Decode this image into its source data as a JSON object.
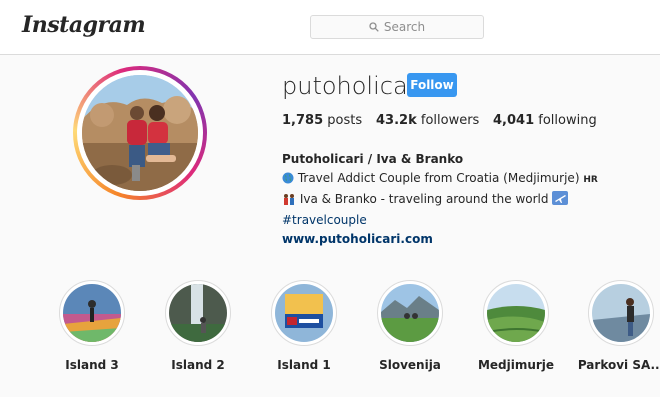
{
  "header": {
    "logo": "Instagram",
    "search_placeholder": "Search"
  },
  "profile": {
    "username": "putoholicari",
    "follow_label": "Follow",
    "posts_count": "1,785",
    "posts_label": "posts",
    "followers_count": "43.2k",
    "followers_label": "followers",
    "following_count": "4,041",
    "following_label": "following",
    "full_name": "Putoholicari / Iva & Branko",
    "bio_line1": "Travel Addict Couple from Croatia (Medjimurje)",
    "bio_line1_suffix": "HR",
    "bio_line2": "Iva & Branko - traveling around the world",
    "hashtag": "#travelcouple",
    "website": "www.putoholicari.com"
  },
  "highlights": [
    {
      "label": "Island 3",
      "icon": "highlight-island3"
    },
    {
      "label": "Island 2",
      "icon": "highlight-island2"
    },
    {
      "label": "Island 1",
      "icon": "highlight-island1"
    },
    {
      "label": "Slovenija",
      "icon": "highlight-slovenija"
    },
    {
      "label": "Medjimurje",
      "icon": "highlight-medjimurje"
    },
    {
      "label": "Parkovi SA...",
      "icon": "highlight-parkovi"
    }
  ],
  "colors": {
    "follow_button": "#3897f0",
    "link": "#003569",
    "background": "#fafafa"
  }
}
